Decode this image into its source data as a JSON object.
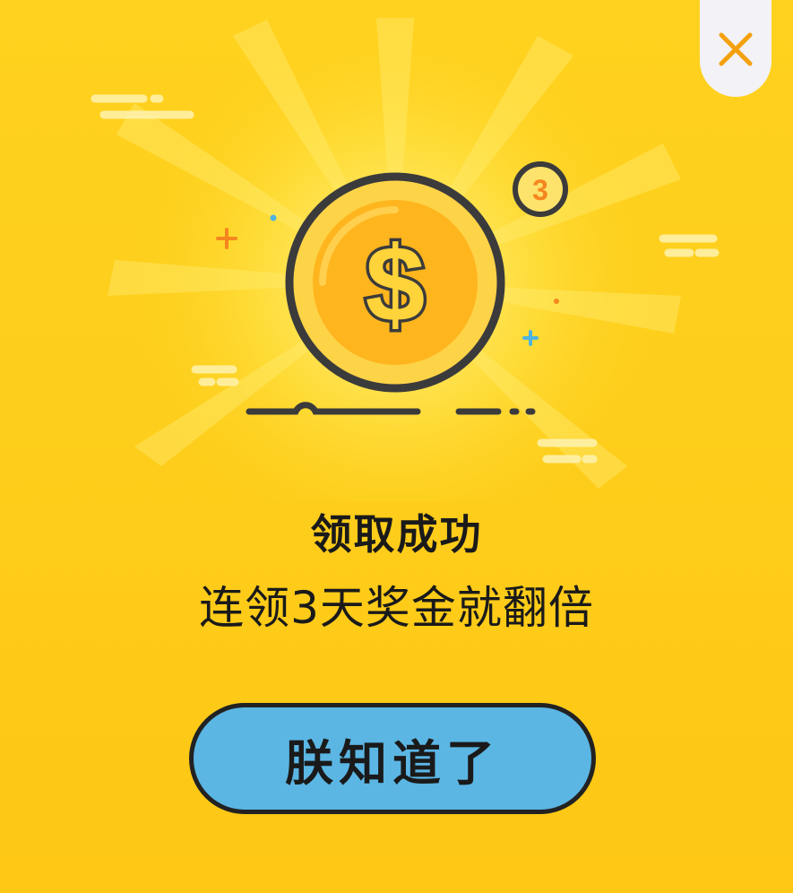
{
  "dialog": {
    "title": "领取成功",
    "subtitle": "连领3天奖金就翻倍",
    "button_label": "朕知道了",
    "badge_text": "3",
    "coin_symbol": "$"
  },
  "icons": {
    "close": "close-icon",
    "coin": "dollar-coin-icon",
    "badge": "day-count-badge"
  },
  "colors": {
    "background": "#ffd21f",
    "close_tab": "#f2f2f7",
    "close_icon": "#f5a10e",
    "coin_face": "#ffb51d",
    "coin_rim": "#fdd348",
    "outline": "#3b3b3b",
    "button": "#5bb6e4"
  }
}
